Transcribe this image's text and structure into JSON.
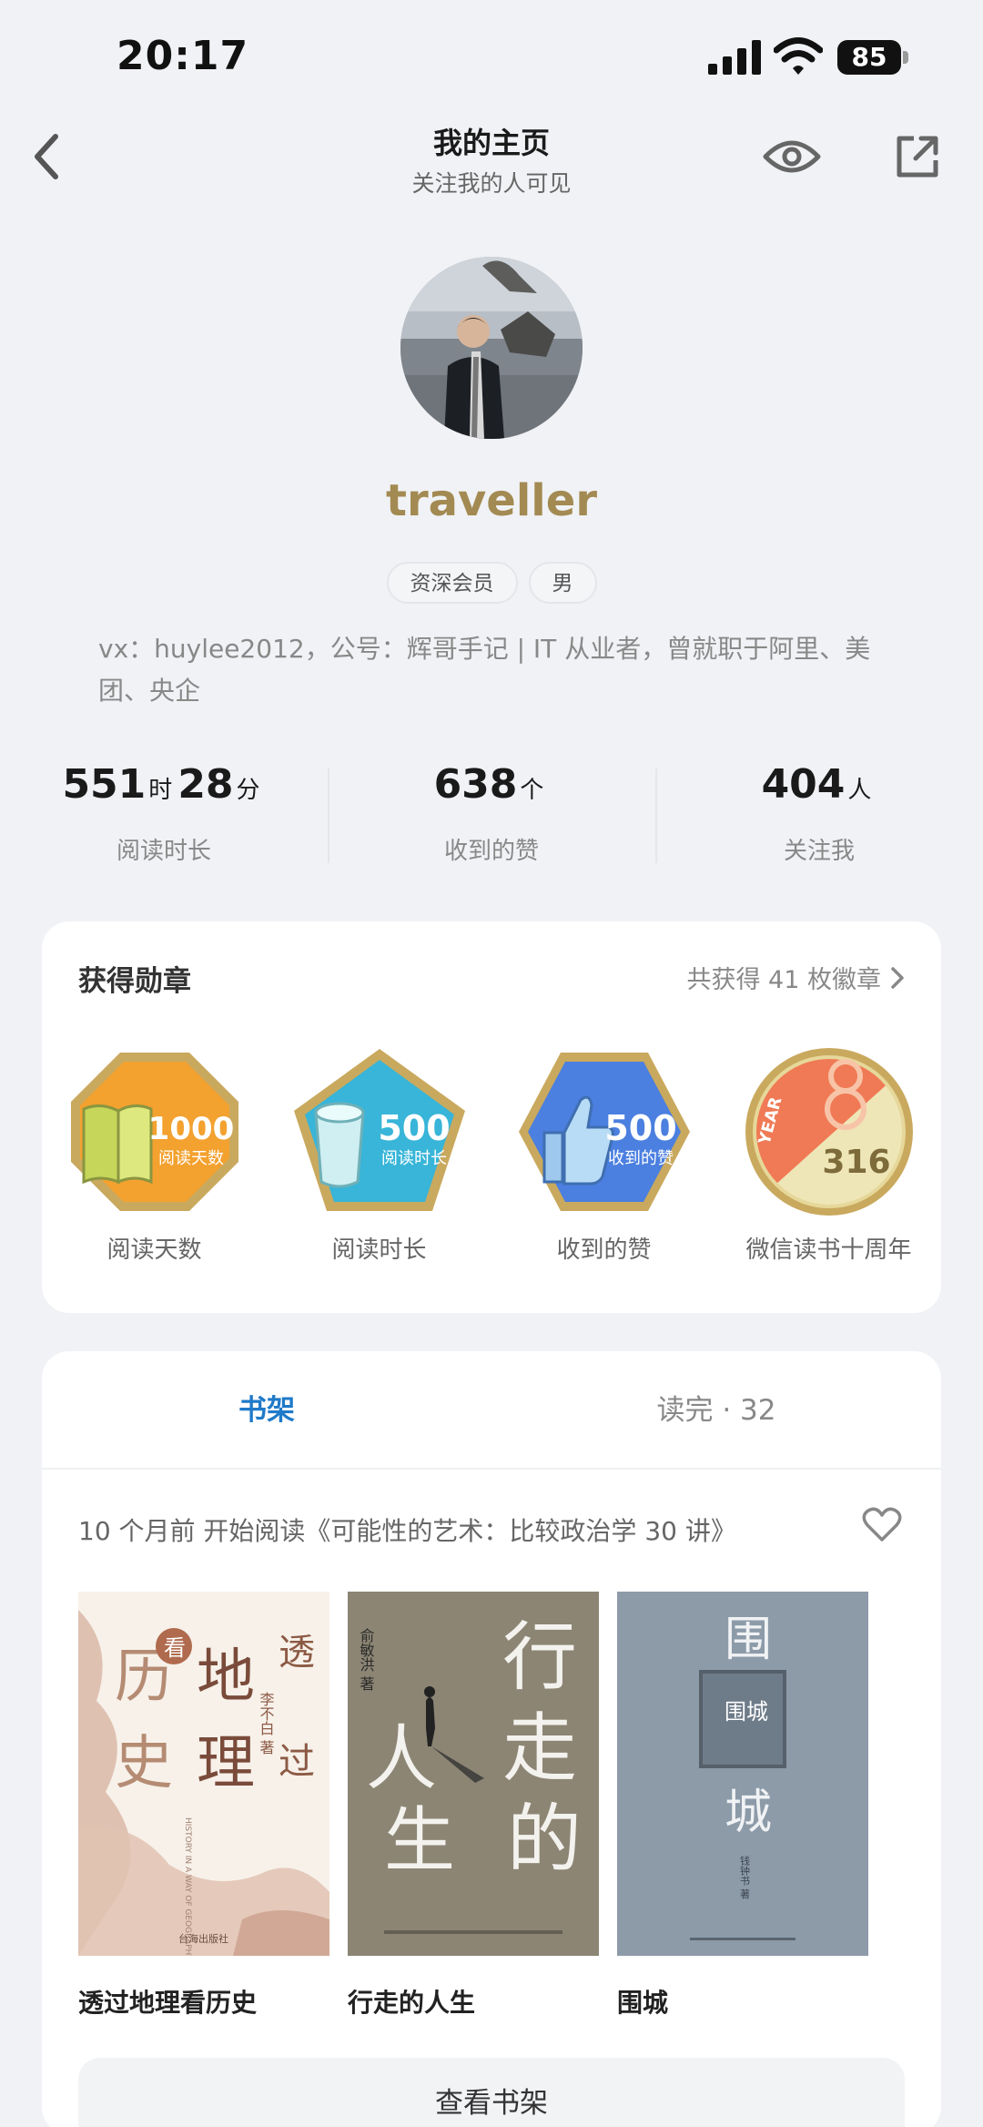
{
  "status_bar": {
    "time": "20:17",
    "battery": "85"
  },
  "nav": {
    "title": "我的主页",
    "subtitle": "关注我的人可见"
  },
  "profile": {
    "username": "traveller",
    "tags": [
      "资深会员",
      "男"
    ],
    "bio": "vx：huylee2012，公号：辉哥手记 | IT 从业者，曾就职于阿里、美团、央企"
  },
  "stats": {
    "reading_time": {
      "hours": "551",
      "hours_unit": "时",
      "minutes": "28",
      "minutes_unit": "分",
      "label": "阅读时长"
    },
    "likes": {
      "value": "638",
      "unit": "个",
      "label": "收到的赞"
    },
    "followers": {
      "value": "404",
      "unit": "人",
      "label": "关注我"
    }
  },
  "medals": {
    "title": "获得勋章",
    "more": "共获得 41 枚徽章",
    "items": [
      {
        "name": "阅读天数",
        "number": "1000",
        "caption": "阅读天数",
        "icon": "book-medal-icon",
        "color": "#f2a12e"
      },
      {
        "name": "阅读时长",
        "number": "500",
        "caption": "阅读时长",
        "icon": "cup-medal-icon",
        "color": "#35b3d6"
      },
      {
        "name": "收到的赞",
        "number": "500",
        "caption": "收到的赞",
        "icon": "thumbs-up-medal-icon",
        "color": "#4a7fe0"
      },
      {
        "name": "微信读书十周年",
        "number": "316",
        "caption": "YEAR",
        "icon": "anniversary-medal-icon",
        "color": "#f07a55"
      }
    ]
  },
  "shelf": {
    "tabs": [
      {
        "label": "书架"
      },
      {
        "label": "读完 · 32"
      }
    ],
    "activity": "10 个月前 开始阅读《可能性的艺术：比较政治学 30 讲》",
    "books": [
      {
        "title": "透过地理看历史",
        "cover_chars": [
          "历",
          "史",
          "地",
          "理",
          "透",
          "过",
          "看"
        ],
        "cover_author": "李不白 著",
        "cover_publisher": "台海出版社",
        "cover_en": "HISTORY IN A WAY OF GEOGRAPHY"
      },
      {
        "title": "行走的人生",
        "cover_chars": [
          "行",
          "走",
          "的",
          "人",
          "生"
        ],
        "cover_author": "俞敏洪 著"
      },
      {
        "title": "围城",
        "cover_chars": [
          "围",
          "城",
          "围城"
        ],
        "cover_author": "钱钟书 著"
      }
    ],
    "view_button": "查看书架"
  },
  "colors": {
    "accent": "#1f7ac9",
    "username": "#a38a52",
    "background": "#f0f2f5"
  }
}
